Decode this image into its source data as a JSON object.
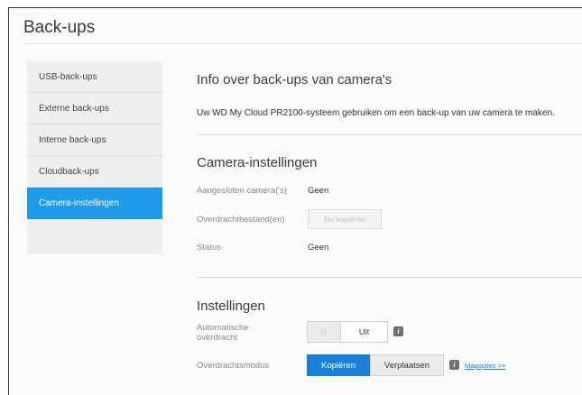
{
  "page": {
    "title": "Back-ups"
  },
  "sidebar": {
    "items": [
      {
        "label": "USB-back-ups",
        "active": false
      },
      {
        "label": "Externe back-ups",
        "active": false
      },
      {
        "label": "Interne back-ups",
        "active": false
      },
      {
        "label": "Cloudback-ups",
        "active": false
      },
      {
        "label": "Camera-instellingen",
        "active": true
      }
    ]
  },
  "info": {
    "title": "Info over back-ups van camera's",
    "description": "Uw WD My Cloud PR2100-systeem gebruiken om een back-up van uw camera te maken."
  },
  "camera": {
    "title": "Camera-instellingen",
    "connected_label": "Aangesloten camera('s)",
    "connected_value": "Geen",
    "transfer_files_label": "Overdrachtbestand(en)",
    "copy_now_button": "Nu kopiëren",
    "status_label": "Status",
    "status_value": "Geen"
  },
  "settings": {
    "title": "Instellingen",
    "auto_transfer_label_line1": "Automatische",
    "auto_transfer_label_line2": "overdracht",
    "toggle_knob": "||",
    "toggle_state": "Uit",
    "transfer_mode_label": "Overdrachtsmodus",
    "mode_copy": "Kopiëren",
    "mode_move": "Verplaatsen",
    "folder_options_link": "Mapopties >>",
    "info_icon_glyph": "i"
  },
  "colors": {
    "accent": "#1e9be9",
    "primary_button": "#1a7fd6",
    "link": "#2a7bc9"
  }
}
